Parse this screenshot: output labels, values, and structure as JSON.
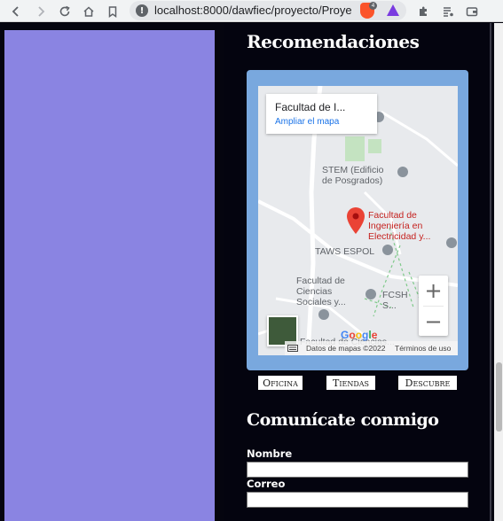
{
  "browser": {
    "url": "localhost:8000/dawfiec/proyecto/Proyecto",
    "icons": [
      "back-icon",
      "forward-icon",
      "reload-icon",
      "home-icon",
      "bookmark-icon",
      "site-info-icon",
      "brave-shields-icon",
      "brave-rewards-icon",
      "extensions-icon",
      "reading-list-icon",
      "wallet-icon"
    ],
    "brave_badge": "4"
  },
  "section": {
    "title": "Recomendaciones"
  },
  "map": {
    "place_title": "Facultad de I...",
    "enlarge_link": "Ampliar el mapa",
    "labels": {
      "stem": "STEM (Edificio de Posgrados)",
      "fiec": "Facultad de Ingeniería en Electricidad y...",
      "taws": "TAWS ESPOL",
      "fcsh": "Facultad de Ciencias Sociales y...",
      "fcsh2": "FCSH S... Profeso...",
      "bottom": "Facultad de Ciencias..."
    },
    "zoom_in": "+",
    "zoom_out": "−",
    "google_logo": "Google",
    "attribution": {
      "data": "Datos de mapas ©2022",
      "terms": "Términos de uso"
    },
    "colors": {
      "pin": "#ea4335",
      "frame": "#79a8de",
      "green": "#7fc98a"
    }
  },
  "nav": {
    "buttons": [
      "Oficina",
      "Tiendas",
      "Descubre"
    ]
  },
  "contact": {
    "title": "Comunícate conmigo",
    "fields": [
      {
        "label": "Nombre",
        "value": ""
      },
      {
        "label": "Correo",
        "value": ""
      }
    ]
  }
}
